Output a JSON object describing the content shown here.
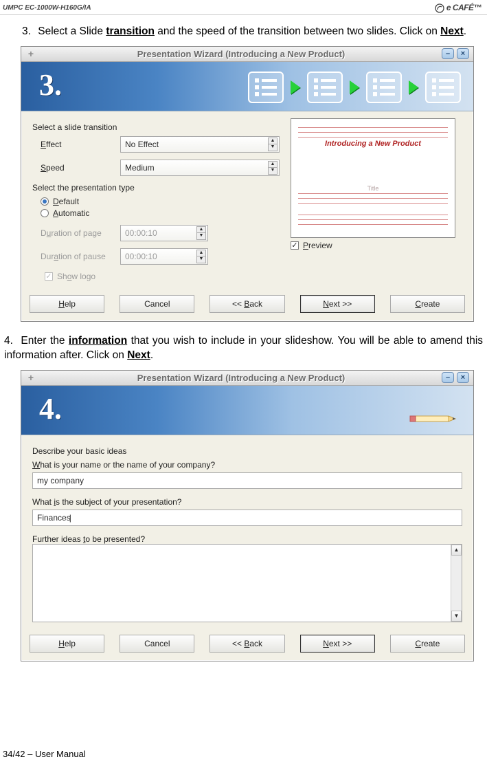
{
  "header": {
    "model": "UMPC EC-1000W-H160G/IA",
    "brand": "e CAFÉ™"
  },
  "instruction3_pre": "3.",
  "instruction3_a": "Select a Slide ",
  "instruction3_word_transition": "transition",
  "instruction3_b": " and the speed of the transition between two slides. Click on ",
  "instruction3_word_next": "Next",
  "instruction4_pre": "4.",
  "instruction4_a": "Enter the ",
  "instruction4_word_info": "information",
  "instruction4_b": " that you wish to include in your slideshow. You will be able to amend this information after. Click on ",
  "instruction4_word_next": "Next",
  "win1": {
    "title": "Presentation Wizard (Introducing a New Product)",
    "step_num": "3.",
    "group_transition": "Select a slide transition",
    "label_effect": "Effect",
    "value_effect": "No Effect",
    "label_speed": "Speed",
    "value_speed": "Medium",
    "group_type": "Select the presentation type",
    "radio_default": "Default",
    "radio_auto": "Automatic",
    "label_dur_page": "Duration of page",
    "value_dur_page": "00:00:10",
    "label_dur_pause": "Duration of pause",
    "value_dur_pause": "00:00:10",
    "label_show_logo": "Show logo",
    "preview_heading": "Introducing a New Product",
    "preview_title": "Title",
    "label_preview": "Preview",
    "btn_help": "Help",
    "btn_cancel": "Cancel",
    "btn_back": "<< Back",
    "btn_next": "Next >>",
    "btn_create": "Create"
  },
  "win2": {
    "title": "Presentation Wizard (Introducing a New Product)",
    "step_num": "4.",
    "group": "Describe your basic ideas",
    "q1": "What is your name or the name of your company?",
    "a1": "my company",
    "q2": "What is the subject of your presentation?",
    "a2": "Finances",
    "q3": "Further ideas to be presented?",
    "btn_help": "Help",
    "btn_cancel": "Cancel",
    "btn_back": "<< Back",
    "btn_next": "Next >>",
    "btn_create": "Create"
  },
  "footer": "34/42 – User Manual"
}
